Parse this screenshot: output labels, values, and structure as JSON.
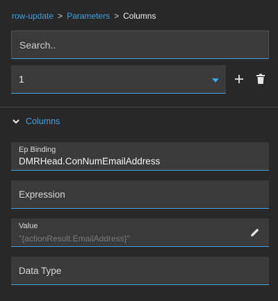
{
  "breadcrumb": {
    "items": [
      "row-update",
      "Parameters"
    ],
    "separator": ">",
    "current": "Columns"
  },
  "search": {
    "placeholder": "Search.."
  },
  "selector": {
    "value": "1"
  },
  "icons": {
    "add": "plus-icon",
    "delete": "trash-icon",
    "expand": "chevron-down-icon",
    "edit": "pencil-icon"
  },
  "section": {
    "title": "Columns"
  },
  "fields": [
    {
      "label": "Ep Binding",
      "value": "DMRHead.ConNumEmailAddress"
    },
    {
      "label": "Expression"
    },
    {
      "label": "Value",
      "placeholder": "\"{actionResult.EmailAddress}\""
    },
    {
      "label": "Data Type"
    }
  ],
  "colors": {
    "accent": "#3fa3e6",
    "background": "#282828",
    "field_bg": "#3a3a3a"
  }
}
